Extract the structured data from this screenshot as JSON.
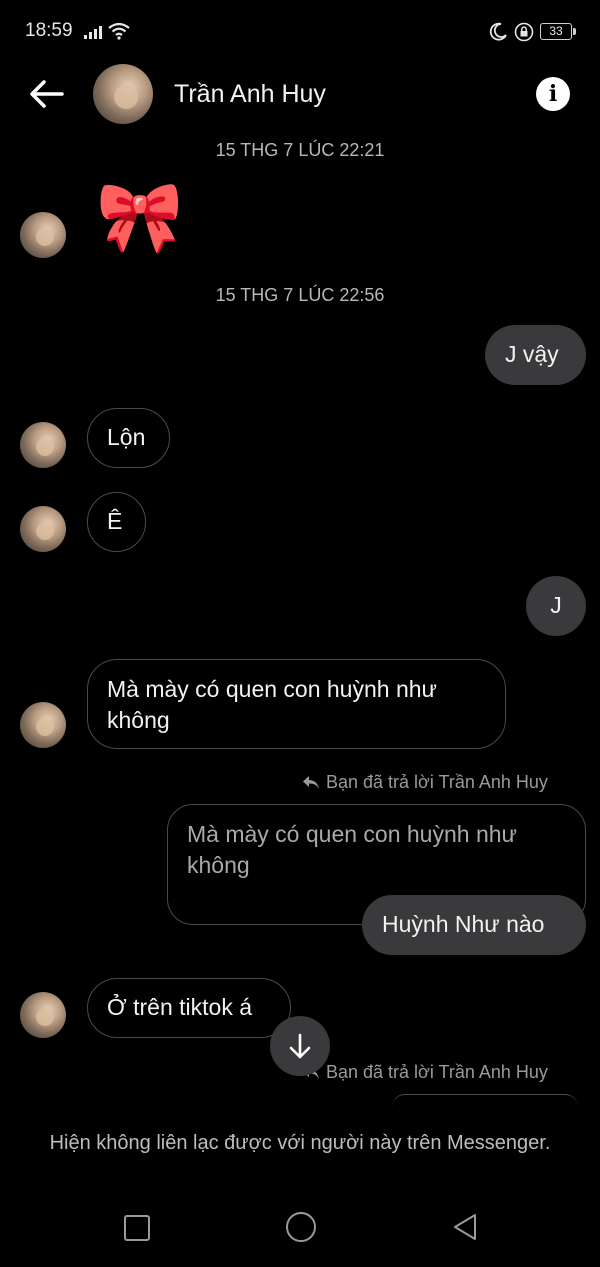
{
  "status_bar": {
    "time": "18:59",
    "battery": "33",
    "icons": [
      "signal-icon",
      "wifi-icon",
      "moon-icon",
      "lock-icon",
      "battery-icon"
    ]
  },
  "header": {
    "contact_name": "Trần Anh Huy",
    "back_icon": "arrow-left-icon",
    "info_icon": "info-icon",
    "info_glyph": "i"
  },
  "messages": {
    "ts1": "15 THG 7 LÚC 22:21",
    "sticker": "🎀",
    "ts2": "15 THG 7 LÚC 22:56",
    "out1": "J vậy",
    "in1": "Lộn",
    "in2": "Ê",
    "out2": "J",
    "in3_line1": "Mà mày có quen con huỳnh như",
    "in3_line2": "không",
    "reply_note1": "Bạn đã trả lời Trần Anh Huy",
    "quote_line1": "Mà mày có quen con huỳnh như",
    "quote_line2": "không",
    "out3": "Huỳnh Như nào",
    "in4": "Ở trên tiktok á",
    "reply_note2": "Bạn đã trả lời Trần Anh Huy"
  },
  "footer": {
    "unavailable_text": "Hiện không liên lạc được với người này trên Messenger."
  },
  "nav_bar": {
    "icons": [
      "recent-apps-icon",
      "home-icon",
      "back-triangle-icon"
    ]
  },
  "colors": {
    "background": "#000000",
    "outgoing_bubble": "#3a3a3c",
    "incoming_border": "#4a4a4a"
  }
}
